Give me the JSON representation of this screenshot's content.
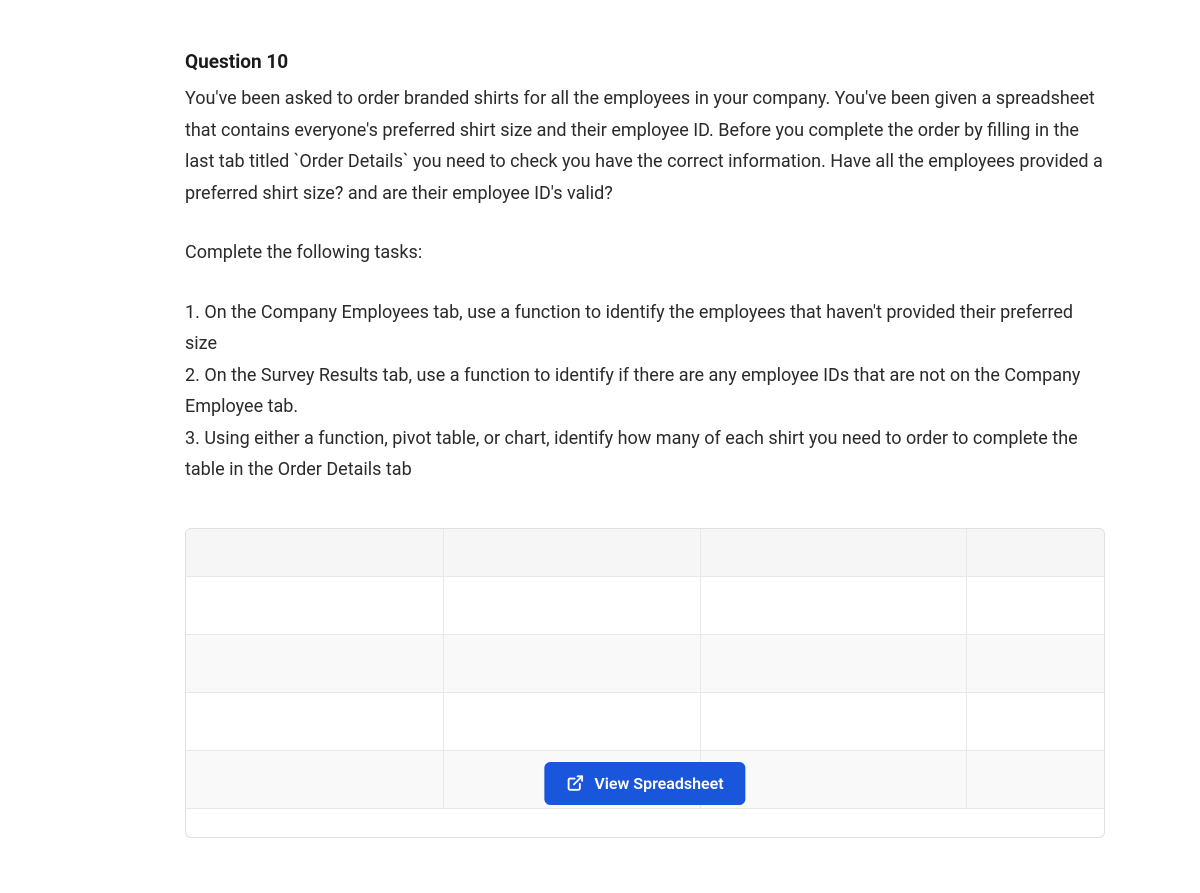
{
  "question": {
    "title": "Question 10",
    "body": "You've been asked to order branded shirts for all the employees in your company. You've been given a spreadsheet that contains everyone's preferred shirt size and their employee ID. Before you complete the order by filling in the last tab titled `Order Details` you need to check you have the correct information. Have all the employees provided a preferred shirt size? and are their employee ID's valid?",
    "tasks_intro": "Complete the following tasks:",
    "tasks": [
      "1. On the Company Employees tab, use a function to identify the employees that haven't provided their preferred size",
      "2. On the Survey Results tab, use a function to identify if there are any employee IDs that are not on the Company Employee tab.",
      "3. Using either a function, pivot table, or chart, identify how many of each shirt you need to order to complete the table in the Order Details tab"
    ]
  },
  "button": {
    "label": "View Spreadsheet"
  }
}
